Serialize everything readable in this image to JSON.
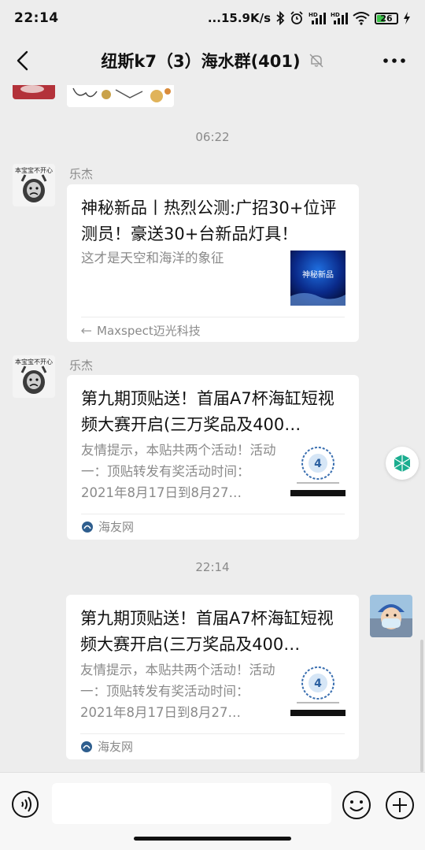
{
  "status": {
    "time": "22:14",
    "network_speed": "...15.9K/s",
    "battery": "26",
    "icons": [
      "bluetooth-icon",
      "alarm-icon",
      "signal-hd-icon",
      "signal-hd-icon",
      "wifi-icon",
      "battery-icon",
      "charging-icon"
    ]
  },
  "nav": {
    "title": "纽斯k7（3）海水群(401)",
    "icons": [
      "back-arrow-icon",
      "mute-bell-icon",
      "more-dots-icon"
    ]
  },
  "messages": [
    {
      "time": "06:22",
      "sender": "乐杰",
      "avatar_text": "本宝宝不开心",
      "card": {
        "title": "神秘新品丨热烈公测:广招30+位评测员！豪送30+台新品灯具！",
        "desc": "这才是天空和海洋的象征",
        "thumb_text": "神秘新品",
        "source": "Maxspect迈光科技"
      }
    },
    {
      "sender": "乐杰",
      "avatar_text": "本宝宝不开心",
      "card": {
        "title": "第九期顶贴送！首届A7杯海缸短视频大赛开启(三万奖品及400…",
        "desc": "友情提示，本贴共两个活动！活动一：顶贴转发有奖活动时间：2021年8月17日到8月27…",
        "source": "海友网"
      }
    },
    {
      "time": "22:14",
      "self": true,
      "card": {
        "title": "第九期顶贴送！首届A7杯海缸短视频大赛开启(三万奖品及400…",
        "desc": "友情提示，本贴共两个活动！活动一：顶贴转发有奖活动时间：2021年8月17日到8月27…",
        "source": "海友网"
      }
    }
  ],
  "input": {
    "placeholder": ""
  },
  "colors": {
    "background": "#ededed",
    "card": "#ffffff",
    "muted_text": "#8a8a8a",
    "battery_fill": "#3cc34a",
    "side_button_green": "#1aad8f"
  }
}
